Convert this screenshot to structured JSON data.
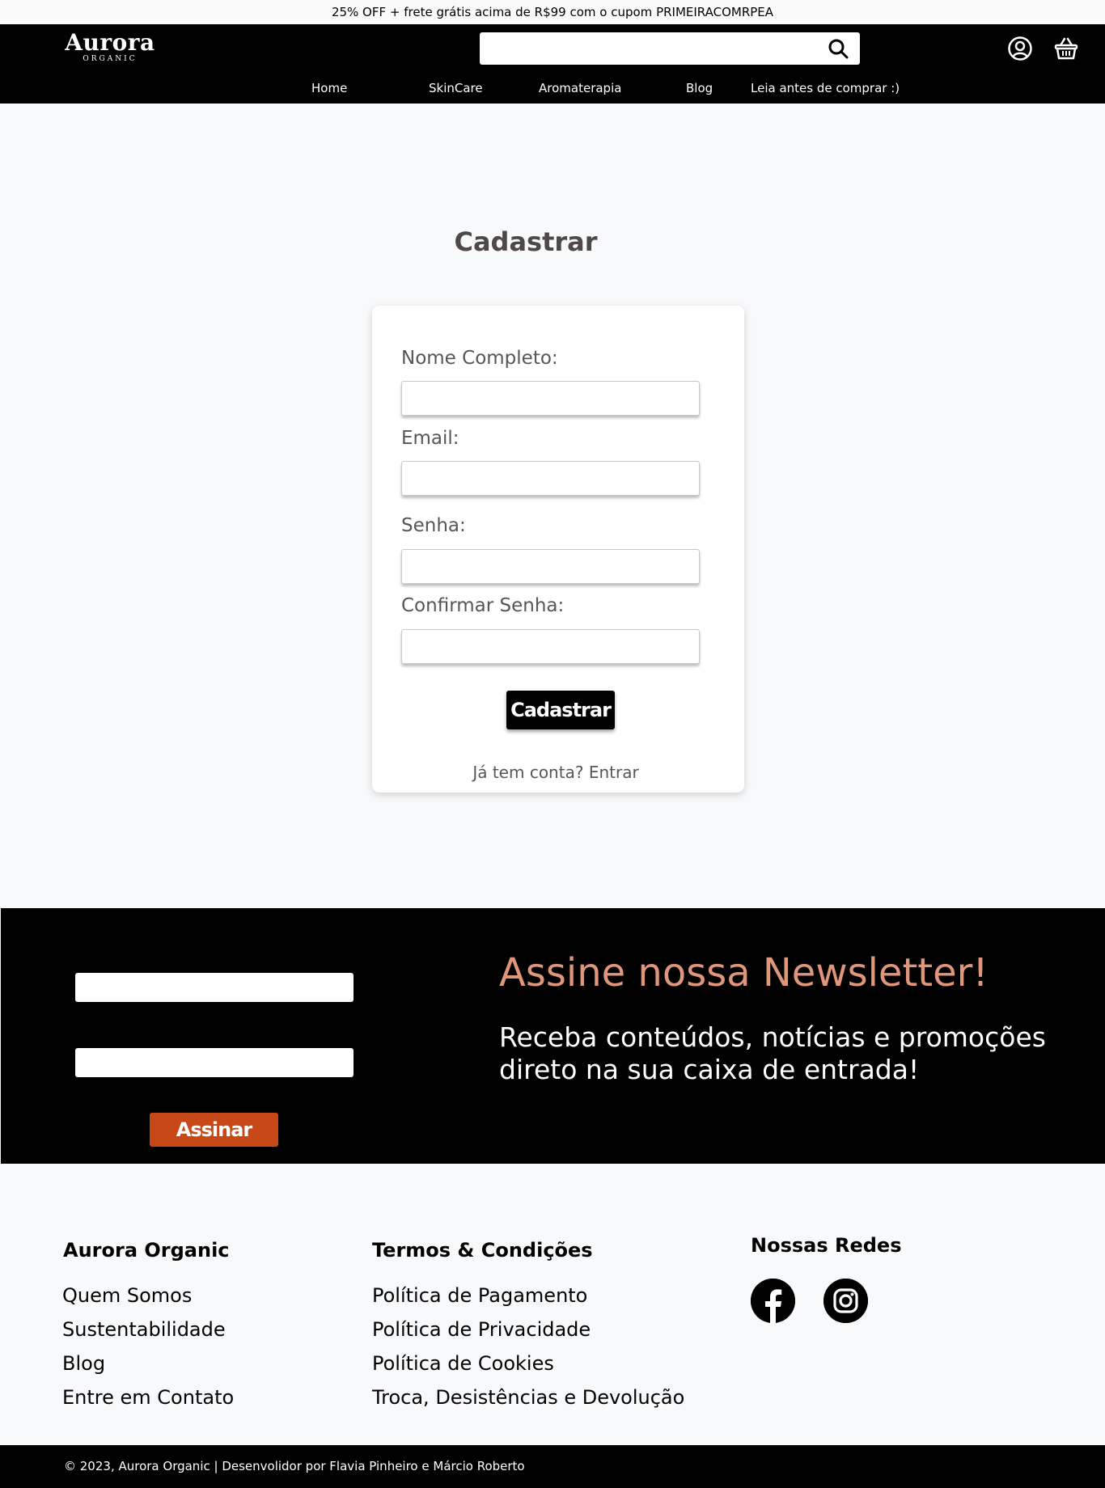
{
  "promo": {
    "text": "25% OFF + frete grátis acima de R$99 com o cupom PRIMEIRACOMRPEA"
  },
  "header": {
    "logo": {
      "name": "Aurora",
      "sub": "ORGANIC"
    },
    "search": {
      "value": "",
      "placeholder": ""
    },
    "icons": {
      "search": "search-icon",
      "account": "user-icon",
      "cart": "basket-icon"
    },
    "nav": [
      "Home",
      "SkinCare",
      "Aromaterapia",
      "Blog",
      "Leia antes de comprar :)"
    ]
  },
  "register": {
    "title": "Cadastrar",
    "fields": [
      {
        "label": "Nome Completo:",
        "value": ""
      },
      {
        "label": "Email:",
        "value": ""
      },
      {
        "label": "Senha:",
        "value": ""
      },
      {
        "label": "Confirmar Senha:",
        "value": ""
      }
    ],
    "submit_label": "Cadastrar",
    "login_prompt": "Já tem conta?",
    "login_link": "Entrar"
  },
  "newsletter": {
    "inputs": [
      {
        "value": ""
      },
      {
        "value": ""
      }
    ],
    "button_label": "Assinar",
    "title": "Assine nossa Newsletter!",
    "text": "Receba conteúdos, notícias e promoções direto na sua caixa de entrada!"
  },
  "footer": {
    "col1": {
      "title": "Aurora Organic",
      "links": [
        "Quem Somos",
        "Sustentabilidade",
        "Blog",
        "Entre em Contato"
      ]
    },
    "col2": {
      "title": "Termos & Condições",
      "links": [
        "Política de Pagamento",
        "Política de Privacidade",
        "Política de Cookies",
        "Troca, Desistências e Devolução"
      ]
    },
    "col3": {
      "title": "Nossas Redes",
      "icons": [
        "facebook-icon",
        "instagram-icon"
      ]
    },
    "copyright": "© 2023, Aurora Organic | Desenvolidor por Flavia Pinheiro e Márcio Roberto"
  },
  "colors": {
    "accent_button": "#c74716",
    "newsletter_title": "#e0967a",
    "header_bg": "#000000",
    "page_bg": "#f8f9fb"
  }
}
